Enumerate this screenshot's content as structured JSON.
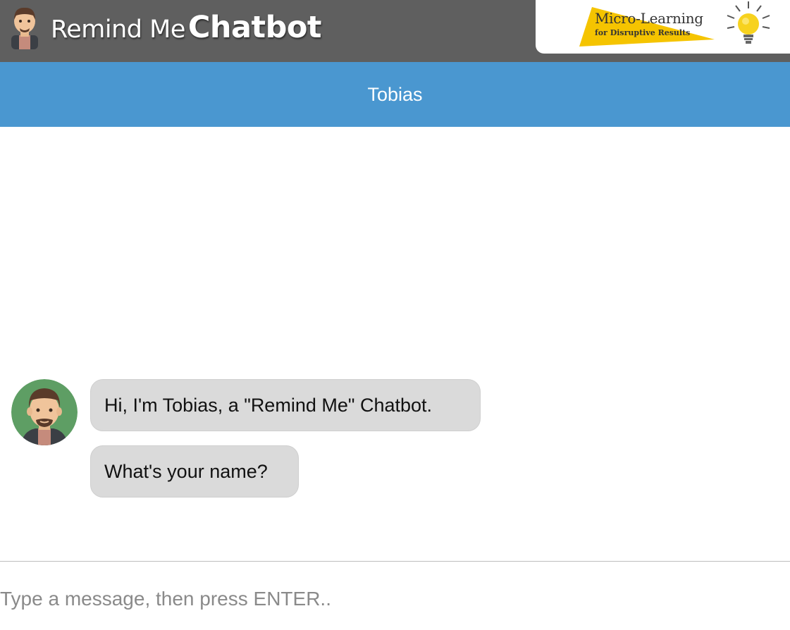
{
  "header": {
    "title_light": "Remind Me",
    "title_bold": "Chatbot",
    "logo": {
      "title": "Micro-Learning",
      "subtitle": "for Disruptive Results",
      "accent_color": "#f5c400"
    },
    "bar_color": "#5f5f5f"
  },
  "chat": {
    "bot_name": "Tobias",
    "header_color": "#4a97d0",
    "avatar_icon": "bot-avatar-icon",
    "messages": [
      {
        "sender": "bot",
        "text": "Hi, I'm Tobias, a \"Remind Me\" Chatbot."
      },
      {
        "sender": "bot",
        "text": "What's your name?"
      }
    ],
    "bubble_color": "#dadada"
  },
  "composer": {
    "placeholder": "Type a message, then press ENTER..",
    "value": ""
  }
}
